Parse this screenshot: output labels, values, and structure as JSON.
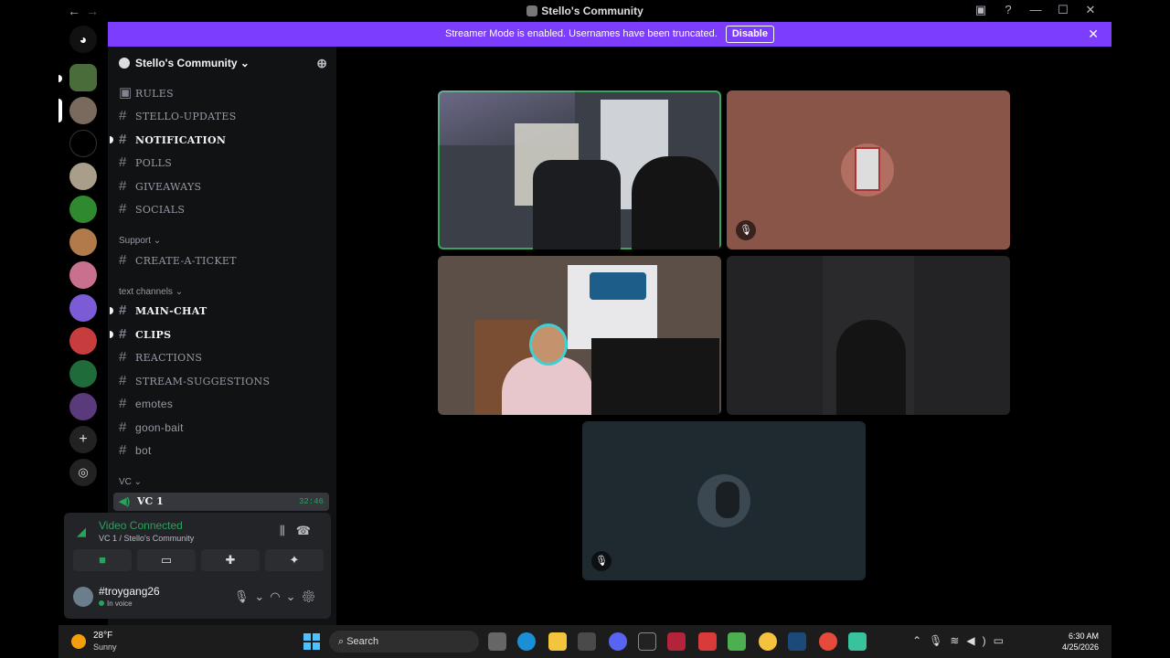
{
  "window": {
    "title": "Stello's Community"
  },
  "banner": {
    "text": "Streamer Mode is enabled. Usernames have been truncated.",
    "disable_label": "Disable"
  },
  "guild": {
    "name": "Stello's Community ⌄"
  },
  "channels": {
    "top": [
      {
        "name": "RULES",
        "bold": false
      },
      {
        "name": "STELLO-UPDATES",
        "bold": false
      },
      {
        "name": "NOTIFICATION",
        "bold": true
      },
      {
        "name": "POLLS",
        "bold": false
      },
      {
        "name": "GIVEAWAYS",
        "bold": false
      },
      {
        "name": "SOCIALS",
        "bold": false
      }
    ],
    "support_label": "Support ⌄",
    "support": [
      {
        "name": "CREATE-A-TICKET"
      }
    ],
    "text_label": "text channels ⌄",
    "text": [
      {
        "name": "MAIN-CHAT",
        "bold": true
      },
      {
        "name": "CLIPS",
        "bold": true
      },
      {
        "name": "REACTIONS",
        "bold": false
      },
      {
        "name": "STREAM-SUGGESTIONS",
        "bold": false
      },
      {
        "name": "emotes",
        "bold": false
      },
      {
        "name": "goon-bait",
        "bold": false
      },
      {
        "name": "bot",
        "bold": false
      }
    ],
    "vc_label": "VC ⌄",
    "vc1": {
      "name": "VC 1",
      "timer": "32:46"
    }
  },
  "voice_panel": {
    "status": "Video Connected",
    "subtitle": "VC 1 / Stello's Community",
    "user": {
      "name": "#troygang26",
      "status": "In voice"
    }
  },
  "video_tiles": [
    {
      "color": "#3b4048",
      "speaking": true,
      "muted": false,
      "kind": "room-camera"
    },
    {
      "color": "#8a5549",
      "speaking": false,
      "muted": true,
      "kind": "avatar"
    },
    {
      "color": "#5b4f48",
      "speaking": false,
      "muted": false,
      "kind": "person-camera"
    },
    {
      "color": "#232325",
      "speaking": false,
      "muted": false,
      "kind": "dark-camera"
    },
    {
      "color": "#1f2a30",
      "speaking": false,
      "muted": true,
      "kind": "avatar"
    }
  ],
  "taskbar": {
    "weather_temp": "28°F",
    "weather_cond": "Sunny",
    "search_placeholder": "Search",
    "time": "6:30 AM",
    "date": "4/25/2026"
  },
  "colors": {
    "accent": "#7d3dfc",
    "voice_green": "#23a55a",
    "speaking_border": "#3ba55d"
  }
}
